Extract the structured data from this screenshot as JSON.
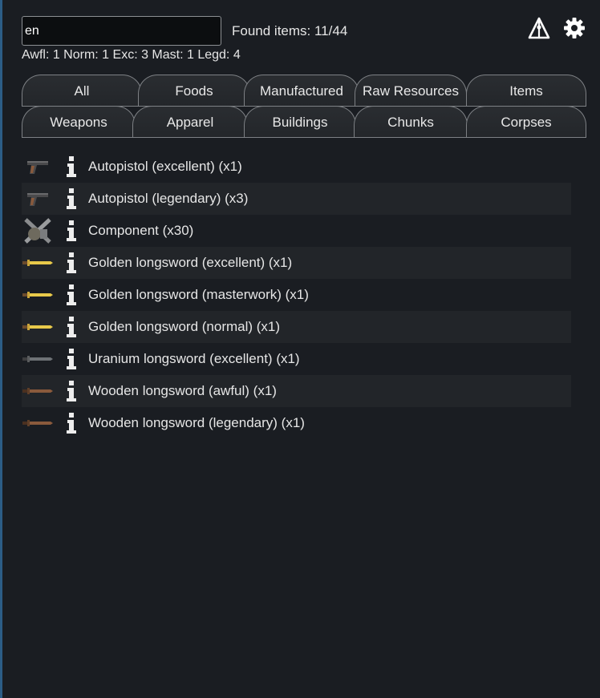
{
  "search": {
    "value": "en",
    "found_label": "Found items: 11/44",
    "quality_summary": "Awfl: 1 Norm: 1 Exc: 3 Mast: 1 Legd: 4"
  },
  "toolbar": {
    "beacon_icon": "triangle-beacon-icon",
    "settings_icon": "gear-icon"
  },
  "tabs": {
    "row1": [
      "All",
      "Foods",
      "Manufactured",
      "Raw Resources",
      "Items"
    ],
    "row2": [
      "Weapons",
      "Apparel",
      "Buildings",
      "Chunks",
      "Corpses"
    ]
  },
  "items": [
    {
      "label": "Autopistol (excellent) (x1)",
      "icon": "pistol-icon"
    },
    {
      "label": "Autopistol (legendary) (x3)",
      "icon": "pistol-icon"
    },
    {
      "label": "Component (x30)",
      "icon": "component-icon"
    },
    {
      "label": "Golden longsword (excellent) (x1)",
      "icon": "golden-sword-icon"
    },
    {
      "label": "Golden longsword (masterwork) (x1)",
      "icon": "golden-sword-icon"
    },
    {
      "label": "Golden longsword (normal) (x1)",
      "icon": "golden-sword-icon"
    },
    {
      "label": "Uranium longsword (excellent) (x1)",
      "icon": "uranium-sword-icon"
    },
    {
      "label": "Wooden longsword (awful) (x1)",
      "icon": "wooden-sword-icon"
    },
    {
      "label": "Wooden longsword (legendary) (x1)",
      "icon": "wooden-sword-icon"
    }
  ],
  "colors": {
    "background": "#1a1d22",
    "row_alt": "#222529",
    "gold": "#e8c94a",
    "uranium": "#6e7276",
    "wood": "#8a5a3c"
  }
}
